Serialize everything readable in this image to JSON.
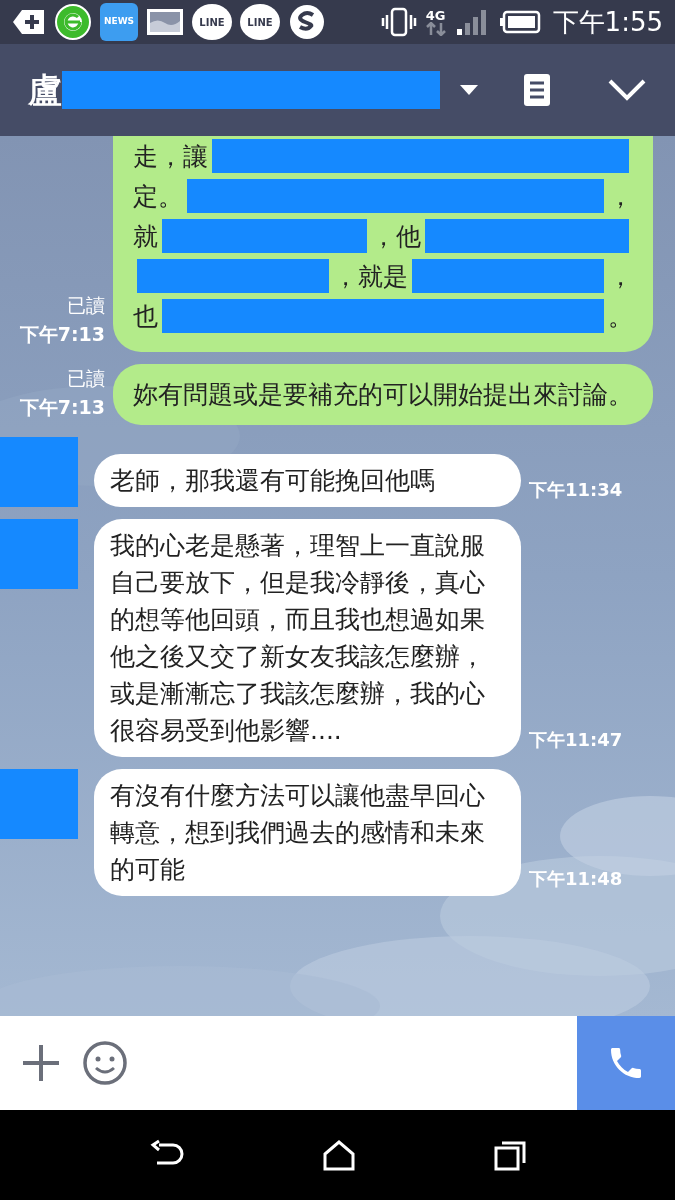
{
  "status_bar": {
    "app_icons": [
      {
        "kind": "add"
      },
      {
        "kind": "browser"
      },
      {
        "kind": "news",
        "label": "NEWS"
      },
      {
        "kind": "gallery"
      },
      {
        "kind": "line",
        "label": "LINE"
      },
      {
        "kind": "line",
        "label": "LINE"
      },
      {
        "kind": "skype"
      }
    ],
    "network": "4G",
    "time": "下午1:55"
  },
  "header": {
    "title": "盧",
    "title_redacted": true
  },
  "messages": [
    {
      "kind": "sent",
      "read": "已讀",
      "time": "下午7:13",
      "cut_top": true,
      "lines": [
        [
          {
            "kind": "text",
            "text": "走，讓"
          },
          {
            "kind": "redacted"
          }
        ],
        [
          {
            "kind": "text",
            "text": "定。"
          },
          {
            "kind": "redacted"
          },
          {
            "kind": "text",
            "text": "，"
          }
        ],
        [
          {
            "kind": "text",
            "text": "就"
          },
          {
            "kind": "redacted"
          },
          {
            "kind": "text",
            "text": "，他"
          },
          {
            "kind": "redacted"
          }
        ],
        [
          {
            "kind": "redacted"
          },
          {
            "kind": "text",
            "text": "，就是"
          },
          {
            "kind": "redacted"
          },
          {
            "kind": "text",
            "text": "，"
          }
        ],
        [
          {
            "kind": "text",
            "text": "也"
          },
          {
            "kind": "redacted"
          },
          {
            "kind": "text",
            "text": "。"
          }
        ]
      ]
    },
    {
      "kind": "sent",
      "read": "已讀",
      "time": "下午7:13",
      "text": "妳有問題或是要補充的可以開始提出來討論。"
    },
    {
      "kind": "received",
      "avatar_redacted": true,
      "time": "下午11:34",
      "text": "老師，那我還有可能挽回他嗎"
    },
    {
      "kind": "received",
      "avatar_redacted": true,
      "time": "下午11:47",
      "text": "我的心老是懸著，理智上一直說服自己要放下，但是我冷靜後，真心的想等他回頭，而且我也想過如果他之後又交了新女友我該怎麼辦，或是漸漸忘了我該怎麼辦，我的心很容易受到他影響...."
    },
    {
      "kind": "received",
      "avatar_redacted": true,
      "time": "下午11:48",
      "text": "有沒有什麼方法可以讓他盡早回心轉意，想到我們過去的感情和未來的可能"
    }
  ]
}
